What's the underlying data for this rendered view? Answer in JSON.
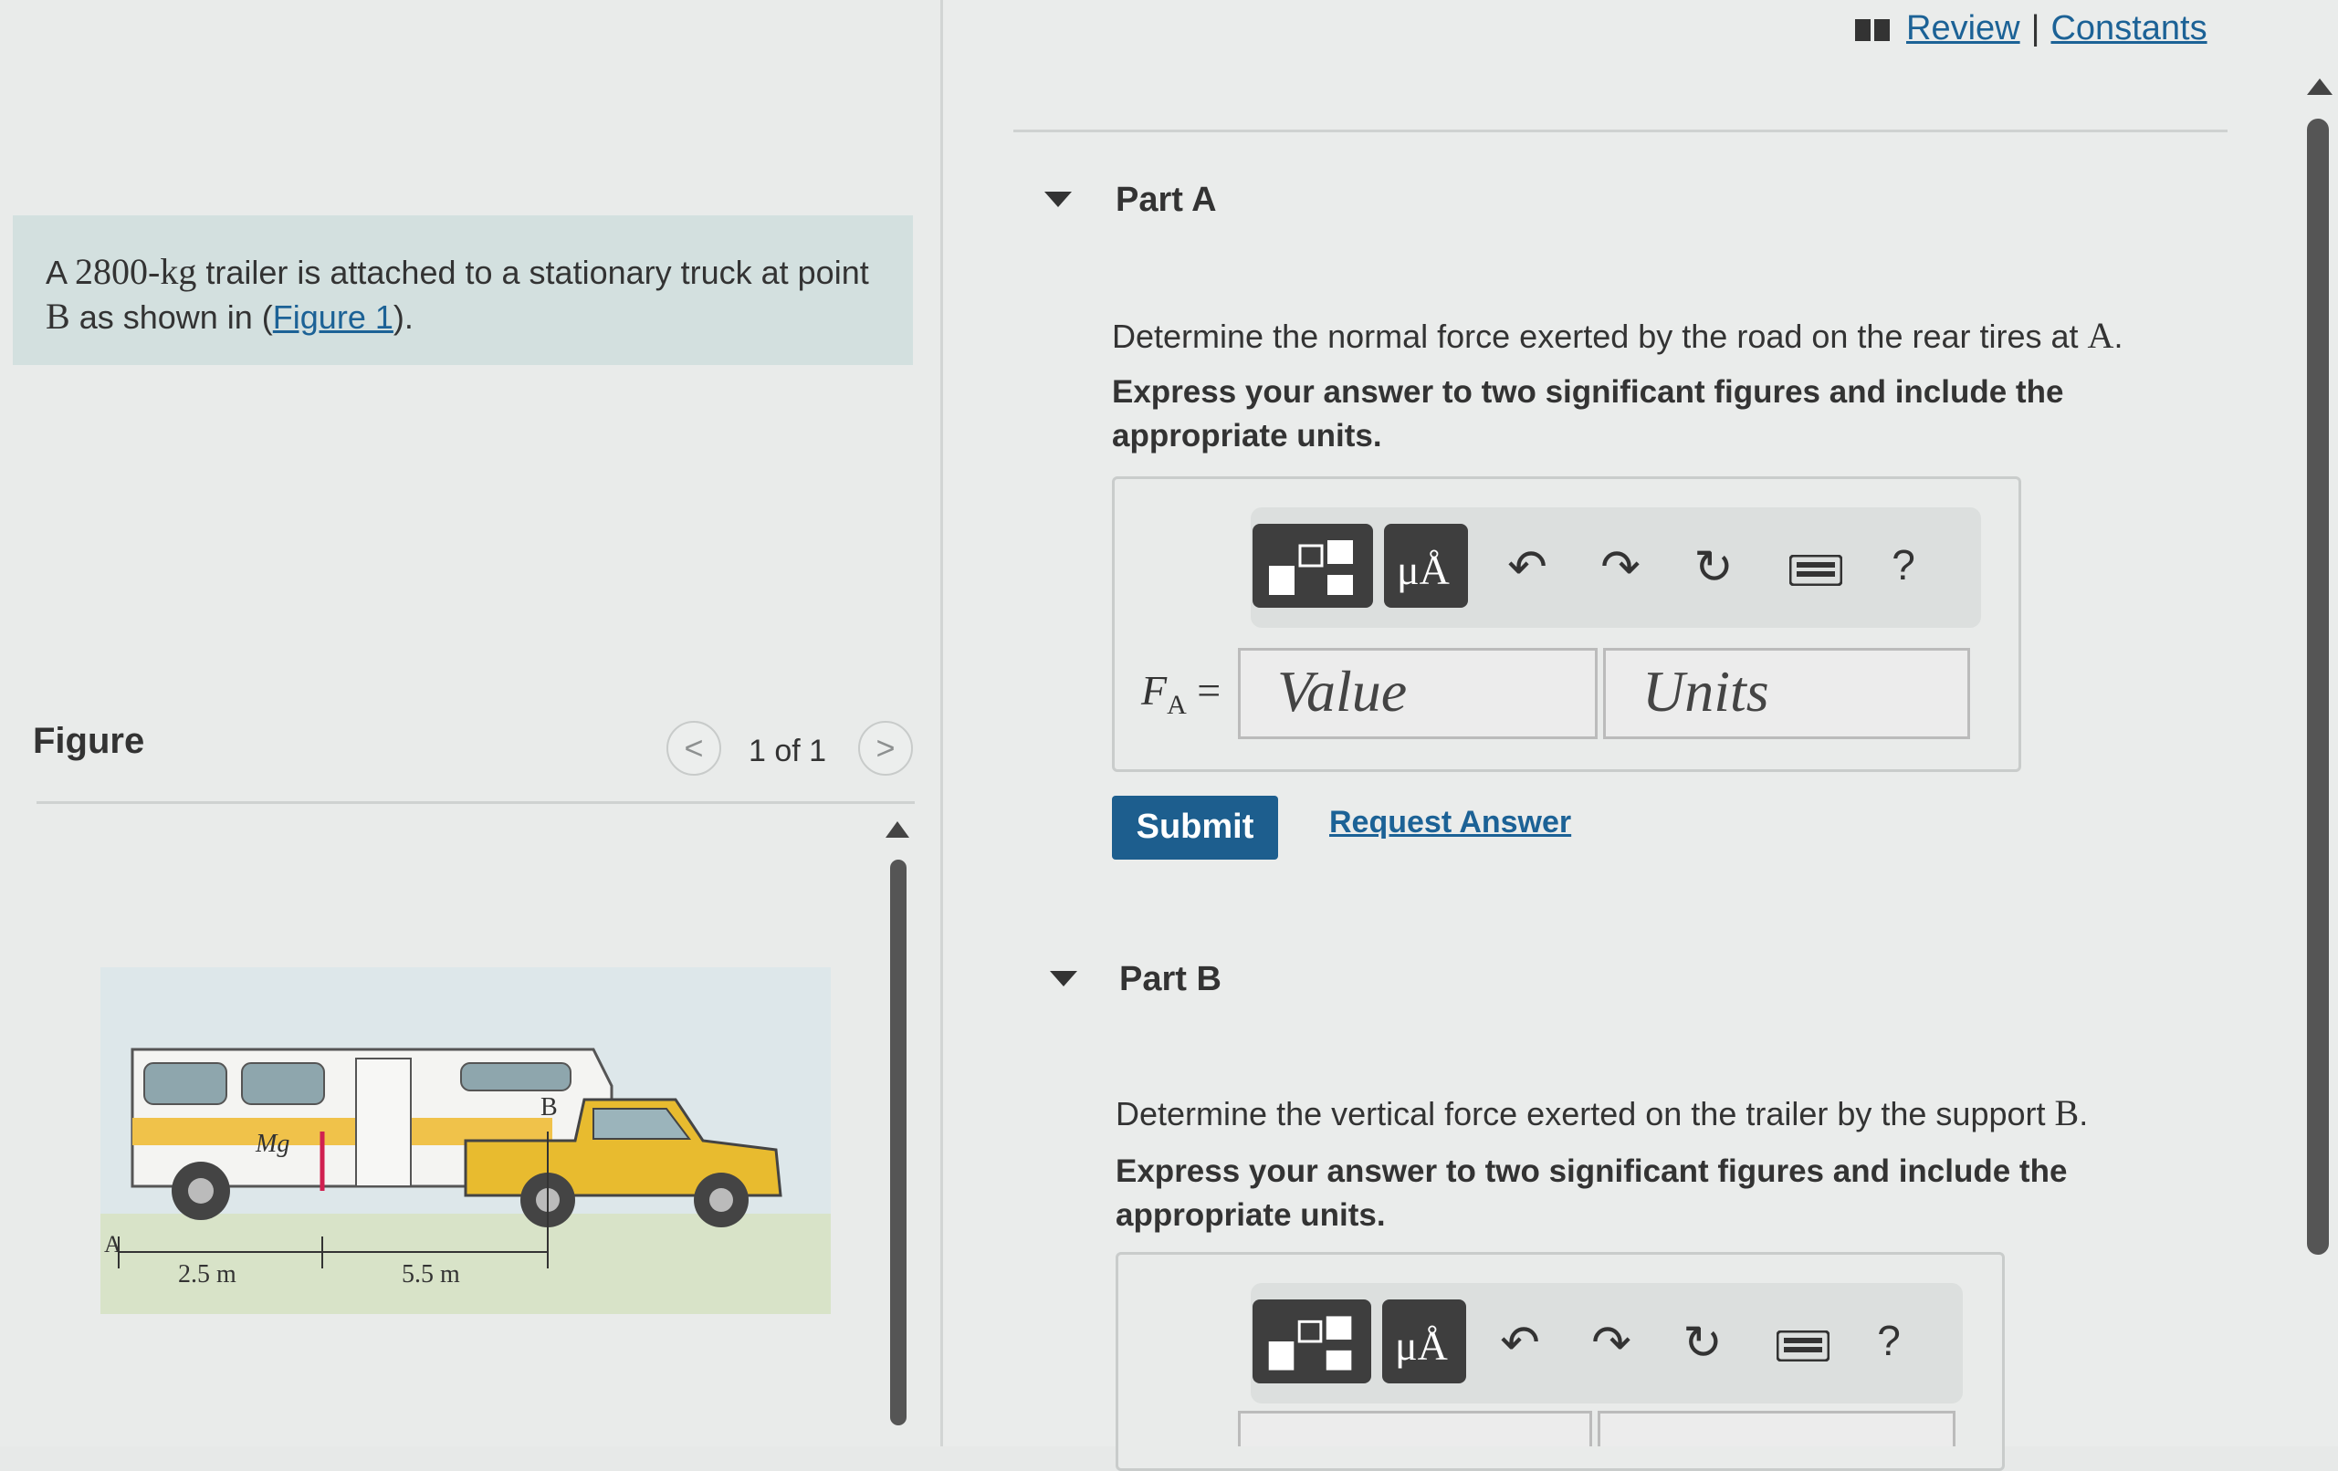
{
  "header": {
    "review_label": "Review",
    "separator": "|",
    "constants_label": "Constants"
  },
  "problem": {
    "intro_a": "A ",
    "mass": "2800-kg",
    "intro_b": " trailer is attached to a stationary truck at point ",
    "point": "B",
    "intro_c": " as shown in (",
    "figure_link": "Figure 1",
    "intro_d": ")."
  },
  "figure": {
    "label": "Figure",
    "pager": "1 of 1",
    "prev_glyph": "<",
    "next_glyph": ">",
    "diagram_labels": {
      "point_a": "A",
      "point_b": "B",
      "weight": "Mg",
      "dist1": "2.5 m",
      "dist2": "5.5 m"
    }
  },
  "part_a": {
    "title": "Part A",
    "question": "Determine the normal force exerted by the road on the rear tires at ",
    "question_var": "A",
    "question_end": ".",
    "instruction": "Express your answer to two significant figures and include the appropriate units.",
    "var_label": "F",
    "var_sub": "A",
    "var_eq": " =",
    "value_placeholder": "Value",
    "units_placeholder": "Units",
    "submit_label": "Submit",
    "request_label": "Request Answer"
  },
  "part_b": {
    "title": "Part B",
    "question": "Determine the vertical force exerted on the trailer by the support ",
    "question_var": "B",
    "question_end": ".",
    "instruction": "Express your answer to two significant figures and include the appropriate units."
  },
  "toolbar": {
    "mu_label": "μÅ",
    "undo": "↶",
    "redo": "↷",
    "reset": "↻",
    "help": "?"
  }
}
